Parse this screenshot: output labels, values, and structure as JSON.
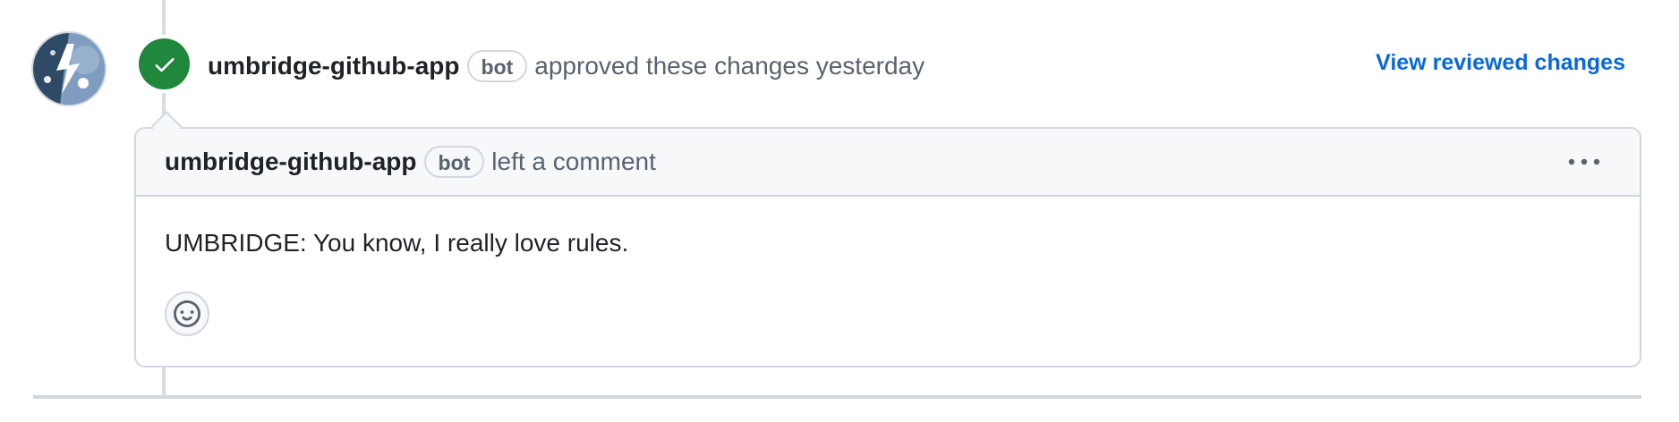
{
  "review": {
    "author": "umbridge-github-app",
    "bot_badge": "bot",
    "action_text": "approved these changes yesterday",
    "view_link": "View reviewed changes",
    "status_color": "#1f883d"
  },
  "comment": {
    "author": "umbridge-github-app",
    "bot_badge": "bot",
    "action_text": "left a comment",
    "body": "UMBRIDGE: You know, I really love rules."
  },
  "icons": {
    "avatar": "app-avatar-icon",
    "status": "check-icon",
    "menu": "kebab-horizontal-icon",
    "reaction": "smiley-icon"
  },
  "colors": {
    "link": "#0969da",
    "muted_text": "#59636e",
    "border": "#d0d7de"
  }
}
